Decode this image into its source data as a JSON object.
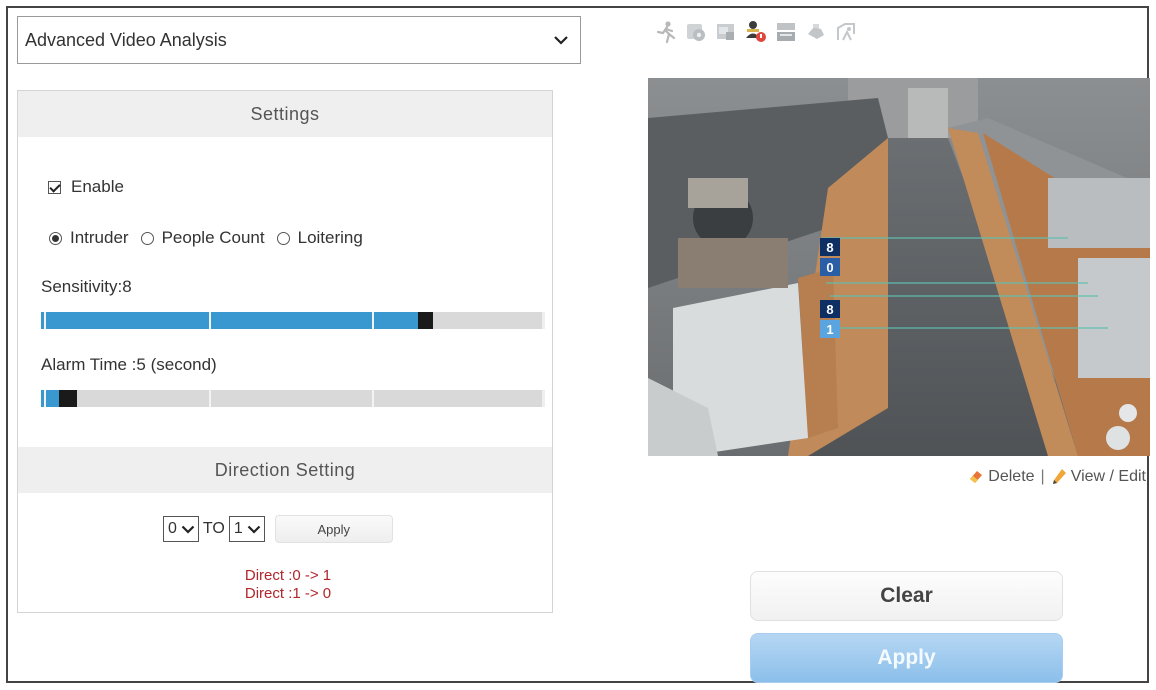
{
  "mode_select": {
    "value": "Advanced Video Analysis"
  },
  "settings": {
    "header": "Settings",
    "enable_label": "Enable",
    "enable_checked": true,
    "modes": [
      {
        "label": "Intruder",
        "selected": true
      },
      {
        "label": "People Count",
        "selected": false
      },
      {
        "label": "Loitering",
        "selected": false
      }
    ],
    "sensitivity_label": "Sensitivity:8",
    "sensitivity_value": 8,
    "alarm_time_label": "Alarm Time :5 (second)",
    "alarm_time_value": 5
  },
  "direction": {
    "header": "Direction Setting",
    "from_value": "0",
    "to_label": "TO",
    "to_value": "1",
    "apply_label": "Apply",
    "list": [
      "Direct :0 -> 1",
      "Direct :1 -> 0"
    ]
  },
  "video": {
    "line_labels": [
      "8",
      "0",
      "8",
      "1"
    ]
  },
  "actions": {
    "delete_label": "Delete",
    "separator": "|",
    "view_edit_label": "View / Edit",
    "clear_label": "Clear",
    "apply_label": "Apply"
  },
  "colors": {
    "slider_fill": "#3a98d0",
    "slider_track": "#d9d9d9",
    "direction_text": "#b0262a",
    "apply_button": "#8bbfea"
  },
  "toolbar_icons": [
    "running-person-icon",
    "camera-settings-icon",
    "image-icon",
    "person-alert-icon",
    "counter-icon",
    "hand-icon",
    "loitering-icon"
  ]
}
